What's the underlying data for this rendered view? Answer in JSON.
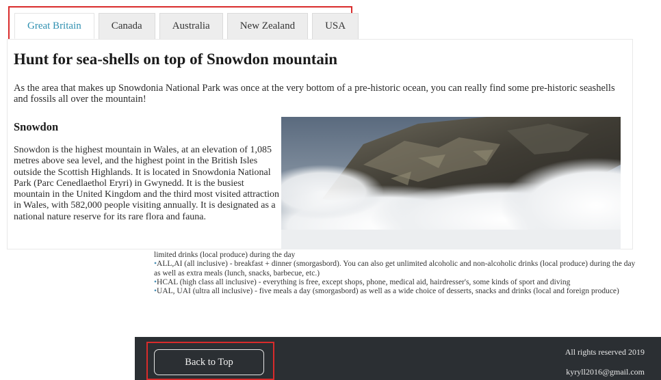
{
  "tabs": [
    {
      "label": "Great Britain",
      "active": true
    },
    {
      "label": "Canada",
      "active": false
    },
    {
      "label": "Australia",
      "active": false
    },
    {
      "label": "New Zealand",
      "active": false
    },
    {
      "label": "USA",
      "active": false
    }
  ],
  "article": {
    "title": "Hunt for sea-shells on top of Snowdon mountain",
    "intro": "As the area that makes up Snowdonia National Park was once at the very bottom of a pre-historic ocean, you can really find some pre-historic seashells and fossils all over the mountain!",
    "section_title": "Snowdon",
    "section_text": "Snowdon is the highest mountain in Wales, at an elevation of 1,085 metres above sea level, and the highest point in the British Isles outside the Scottish Highlands. It is located in Snowdonia National Park (Parc Cenedlaethol Eryri) in Gwynedd. It is the busiest mountain in the United Kingdom and the third most visited attraction in Wales, with 582,000 people visiting annually. It is designated as a national nature reserve for its rare flora and fauna."
  },
  "meal_plans": {
    "line0": "limited drinks (local produce) during the day",
    "items": [
      "ALL,AI (all inclusive) - breakfast + dinner (smorgasbord). You can also get unlimited alcoholic and non-alcoholic drinks (local produce) during the day as well as extra meals (lunch, snacks, barbecue, etc.)",
      "HCAL (high class all inclusive) - everything is free, except shops, phone, medical aid, hairdresser's, some kinds of sport and diving",
      "UAL, UAI (ultra all inclusive) - five meals a day (smorgasbord) as well as a wide choice of desserts, snacks and drinks (local and foreign produce)"
    ],
    "bullet": "•"
  },
  "footer": {
    "back_to_top": "Back to Top",
    "rights": "All rights reserved 2019",
    "email": "kyryll2016@gmail.com"
  }
}
